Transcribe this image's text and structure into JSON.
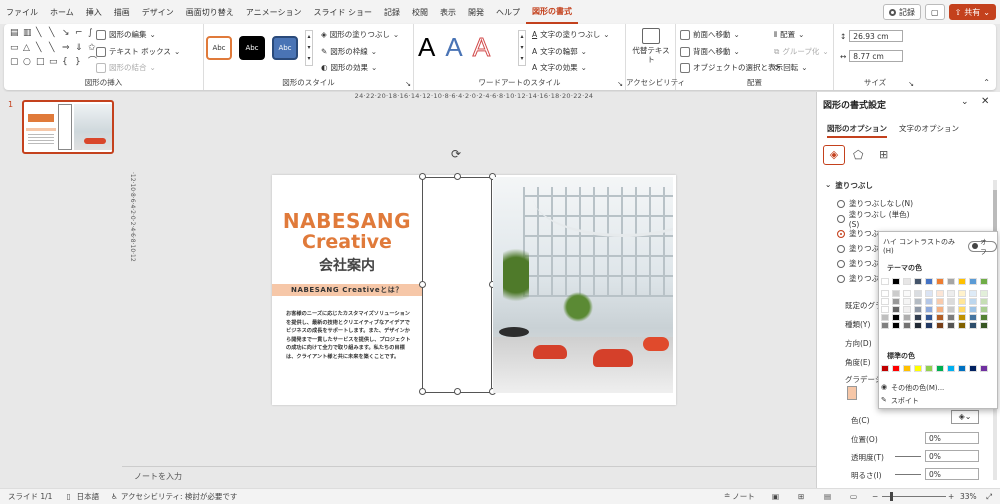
{
  "tabs": [
    "ファイル",
    "ホーム",
    "挿入",
    "描画",
    "デザイン",
    "画面切り替え",
    "アニメーション",
    "スライド ショー",
    "記録",
    "校閲",
    "表示",
    "開発",
    "ヘルプ",
    "図形の書式"
  ],
  "record_btn": "記録",
  "share_btn": "共有",
  "ribbon": {
    "insert_shapes": {
      "edit": "図形の編集",
      "textbox": "テキスト ボックス",
      "merge": "図形の結合",
      "label": "図形の挿入"
    },
    "styles": {
      "swatch1": "Abc",
      "swatch2": "Abc",
      "swatch3": "Abc",
      "fill": "図形の塗りつぶし",
      "outline": "図形の枠線",
      "effects": "図形の効果",
      "label": "図形のスタイル"
    },
    "wordart": {
      "text_fill": "文字の塗りつぶし",
      "text_outline": "文字の輪郭",
      "text_effects": "文字の効果",
      "label": "ワードアートのスタイル",
      "letters": [
        "A",
        "A",
        "A"
      ]
    },
    "accessibility": {
      "alt_text": "代替テキスト",
      "label": "アクセシビリティ"
    },
    "arrange": {
      "forward": "前面へ移動",
      "backward": "背面へ移動",
      "selection": "オブジェクトの選択と表示",
      "align": "配置",
      "group": "グループ化",
      "rotate": "回転",
      "label": "配置"
    },
    "size": {
      "height": "26.93 cm",
      "width": "8.77 cm",
      "label": "サイズ"
    }
  },
  "ruler": {
    "h": "24·22·20·18·16·14·12·10·8·6·4·2·0·2·4·6·8·10·12·14·16·18·20·22·24",
    "v": "·12·10·8·6·4·2·0·2·4·6·8·10·12"
  },
  "slide_number": "1",
  "slide": {
    "brand1": "NABESANG",
    "brand2": "Creative",
    "subtitle": "会社案内",
    "banner": "NABESANG Creativeとは？",
    "body": "お客様のニーズに応じたカスタマイズソリューションを提供し、最新の技術とクリエイティブなアイデアでビジネスの成長をサポートします。また、デザインから開発まで一貫したサービスを提供し、プロジェクトの成功に向けて全力で取り組みます。私たちの目標は、クライアント様と共に未来を築くことです。"
  },
  "notes": "ノートを入力",
  "pane": {
    "title": "図形の書式設定",
    "tab_shape": "図形のオプション",
    "tab_text": "文字のオプション",
    "section": "塗りつぶし",
    "radios": [
      "塗りつぶしなし(N)",
      "塗りつぶし (単色)(S)",
      "塗りつぶ",
      "塗りつぶ",
      "塗りつぶ",
      "塗りつぶ"
    ],
    "preset": "既定のグラ",
    "type": "種類(Y)",
    "direction": "方向(D)",
    "angle": "角度(E)",
    "gradient": "グラデーショ",
    "color": "色(C)",
    "position": "位置(O)",
    "position_val": "0%",
    "transparency": "透明度(T)",
    "transparency_val": "0%",
    "brightness": "明るさ(I)",
    "brightness_val": "0%"
  },
  "popup": {
    "high_contrast": "ハイ コントラストのみ(H)",
    "toggle": "オフ",
    "theme": "テーマの色",
    "standard": "標準の色",
    "more": "その他の色(M)...",
    "eyedropper": "スポイト"
  },
  "colors": {
    "accent": "#c4411d",
    "brand": "#e07a3a",
    "theme_row": [
      "#ffffff",
      "#000000",
      "#e7e6e6",
      "#44546a",
      "#4472c4",
      "#ed7d31",
      "#a5a5a5",
      "#ffc000",
      "#5b9bd5",
      "#70ad47"
    ],
    "standard_row": [
      "#c00000",
      "#ff0000",
      "#ffc000",
      "#ffff00",
      "#92d050",
      "#00b050",
      "#00b0f0",
      "#0070c0",
      "#002060",
      "#7030a0"
    ]
  },
  "status": {
    "slide": "スライド 1/1",
    "lang": "日本語",
    "access": "アクセシビリティ: 検討が必要です",
    "notes": "ノート",
    "zoom": "33%"
  }
}
